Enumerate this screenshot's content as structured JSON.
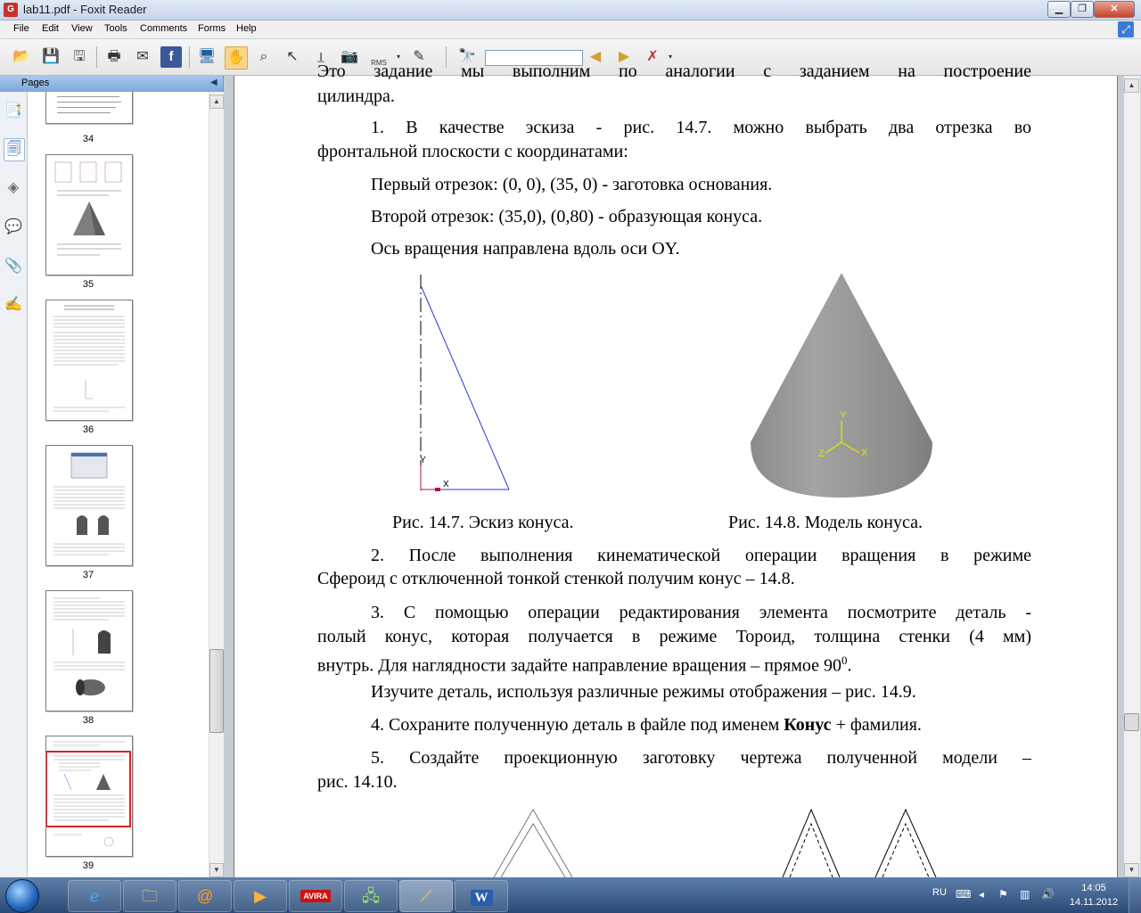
{
  "window": {
    "title": "lab11.pdf - Foxit Reader",
    "app_icon": "foxit-icon"
  },
  "menu": [
    "File",
    "Edit",
    "View",
    "Tools",
    "Comments",
    "Forms",
    "Help"
  ],
  "toolbar": {
    "buttons": [
      "open-icon",
      "save-icon",
      "save-all-icon",
      "print-icon",
      "email-icon",
      "facebook-icon",
      "monitor-icon",
      "hand-tool-icon",
      "snapshot-icon",
      "select-icon",
      "text-select-icon",
      "camera-icon",
      "rms-icon",
      "edit-icon",
      "find-icon",
      "prev-icon",
      "next-icon",
      "highlight-icon"
    ],
    "rms_label": "RMS",
    "find_value": ""
  },
  "sidebar": {
    "header": "Pages",
    "icons": [
      "bookmarks-icon",
      "pages-icon",
      "layers-icon",
      "comments-icon",
      "attachments-icon",
      "signatures-icon"
    ],
    "pages": [
      "34",
      "35",
      "36",
      "37",
      "38",
      "39"
    ],
    "current_page": "39"
  },
  "document": {
    "line0": "Это задание мы выполним по аналогии с заданием на построение",
    "line1": "цилиндра.",
    "p1a": "1. В качестве эскиза - рис. 14.7. можно выбрать два отрезка во",
    "p1b": "фронтальной плоскости с координатами:",
    "seg1": "Первый отрезок: (0, 0), (35, 0) - заготовка основания.",
    "seg2": "Второй отрезок: (35,0), (0,80) - образующая конуса.",
    "axis": "Ось вращения направлена вдоль оси OY.",
    "fig_left_caption": "Рис. 14.7. Эскиз конуса.",
    "fig_right_caption": "Рис. 14.8. Модель конуса.",
    "sketch_axis_x": "X",
    "sketch_axis_y": "Y",
    "model_axis_x": "X",
    "model_axis_y": "Y",
    "model_axis_z": "Z",
    "p2a": "2. После выполнения кинематической операции вращения в режиме",
    "p2b": "Сфероид с отключенной тонкой стенкой получим конус – 14.8.",
    "p3a": "3. С помощью операции редактирования элемента посмотрите деталь -",
    "p3b": "полый конус, которая получается в режиме Тороид, толщина стенки (4 мм)",
    "p3c": "внутрь. Для наглядности задайте направление вращения – прямое 90",
    "p3c_sup": "0",
    "p3c_end": ".",
    "p4": "Изучите деталь, используя различные режимы отображения – рис. 14.9.",
    "p5_pre": "4. Сохраните полученную деталь в файле под именем ",
    "p5_bold": "Конус",
    "p5_post": " + фамилия.",
    "p6a": "5. Создайте проекционную заготовку чертежа полученной модели –",
    "p6b": "рис. 14.10."
  },
  "taskbar": {
    "apps": [
      "ie-icon",
      "explorer-icon",
      "mail-icon",
      "media-player-icon",
      "avira-icon",
      "network-icon",
      "foxit-icon",
      "word-icon"
    ],
    "avira_label": "AVIRA",
    "word_label": "W",
    "language": "RU",
    "time": "14:05",
    "date": "14.11.2012"
  },
  "colors": {
    "sketch_line": "#2a35d6",
    "axis_yellow": "#e6e600",
    "selected_thumb": "#e02020"
  }
}
